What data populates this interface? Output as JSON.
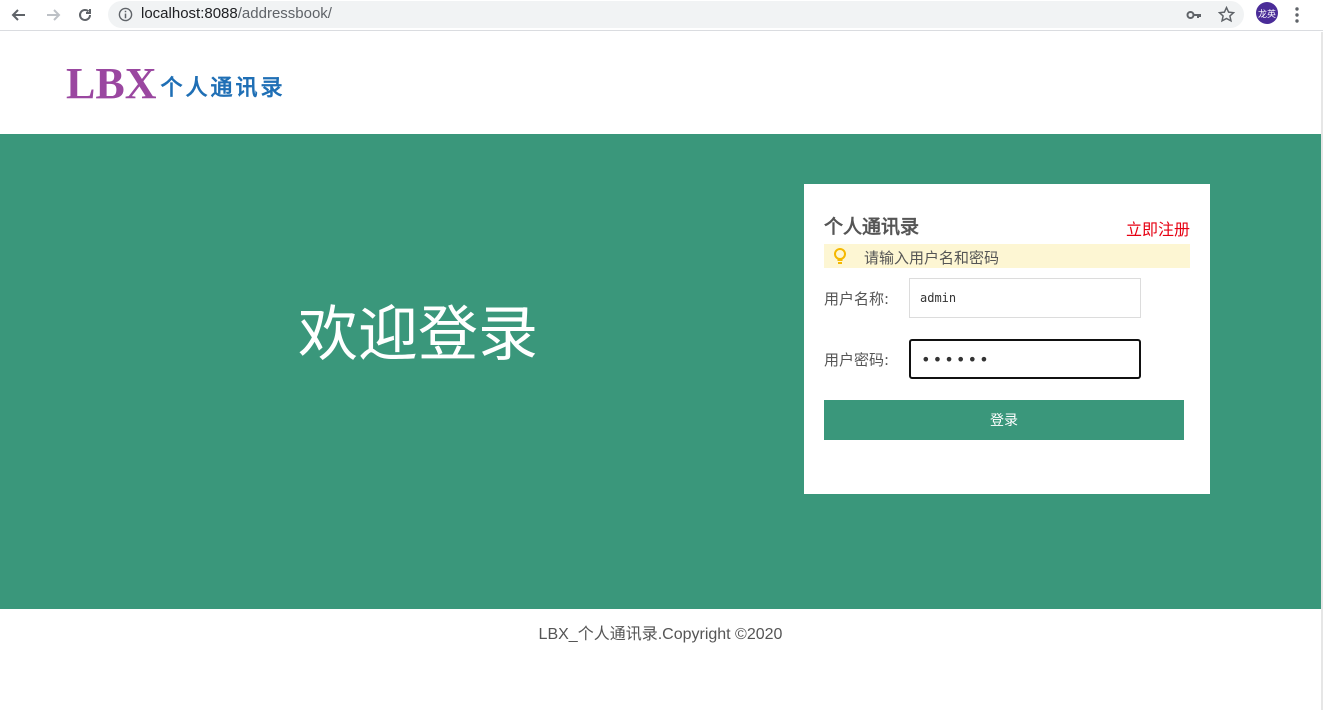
{
  "browser": {
    "url_host": "localhost:8088",
    "url_path": "/addressbook/",
    "avatar_text": "龙英"
  },
  "header": {
    "logo_main": "LBX",
    "logo_sub": "个人通讯录"
  },
  "banner": {
    "welcome": "欢迎登录"
  },
  "login": {
    "title": "个人通讯录",
    "register_link": "立即注册",
    "tip": "请输入用户名和密码",
    "username_label": "用户名称:",
    "username_value": "admin",
    "password_label": "用户密码:",
    "password_value": "••••••",
    "submit_label": "登录"
  },
  "footer": {
    "text": "LBX_个人通讯录.Copyright ©2020"
  },
  "colors": {
    "brand_green": "#3a977b",
    "logo_purple": "#9a47a0",
    "logo_blue": "#1f6fb5",
    "register_red": "#e60012",
    "tip_background": "#fdf6d3"
  }
}
